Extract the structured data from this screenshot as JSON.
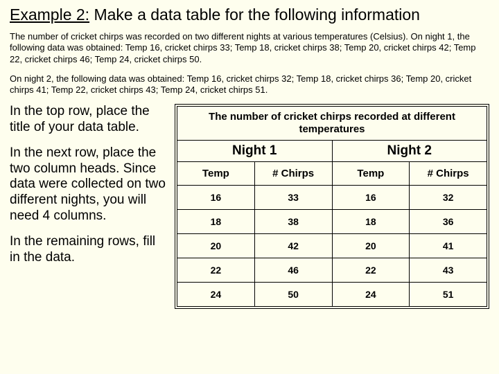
{
  "heading": {
    "label": "Example 2:",
    "text": "Make a data table for the following information"
  },
  "para1": "The number of cricket chirps was recorded on two different nights at various temperatures (Celsius).  On night 1, the following data was obtained:  Temp 16, cricket chirps 33;   Temp 18, cricket chirps 38; Temp 20, cricket chirps 42; Temp 22, cricket chirps 46; Temp 24, cricket chirps 50.",
  "para2": "On night 2, the following data was obtained:  Temp 16, cricket chirps 32;   Temp 18, cricket chirps 36; Temp 20, cricket chirps 41; Temp 22, cricket chirps 43; Temp 24, cricket chirps 51.",
  "instructions": {
    "step1": "In the top row, place the title of your data table.",
    "step2": "In the next row, place the two column heads. Since data were collected on two different nights, you will need 4 columns.",
    "step3": "In the remaining rows, fill in the data."
  },
  "table": {
    "title": "The number of cricket chirps recorded at different temperatures",
    "group1": "Night 1",
    "group2": "Night 2",
    "col_temp": "Temp",
    "col_chirps": "# Chirps"
  },
  "chart_data": {
    "type": "table",
    "title": "The number of cricket chirps recorded at different temperatures",
    "columns": [
      "Temp",
      "# Chirps (Night 1)",
      "Temp",
      "# Chirps (Night 2)"
    ],
    "rows": [
      {
        "n1_temp": 16,
        "n1_chirps": 33,
        "n2_temp": 16,
        "n2_chirps": 32
      },
      {
        "n1_temp": 18,
        "n1_chirps": 38,
        "n2_temp": 18,
        "n2_chirps": 36
      },
      {
        "n1_temp": 20,
        "n1_chirps": 42,
        "n2_temp": 20,
        "n2_chirps": 41
      },
      {
        "n1_temp": 22,
        "n1_chirps": 46,
        "n2_temp": 22,
        "n2_chirps": 43
      },
      {
        "n1_temp": 24,
        "n1_chirps": 50,
        "n2_temp": 24,
        "n2_chirps": 51
      }
    ]
  }
}
